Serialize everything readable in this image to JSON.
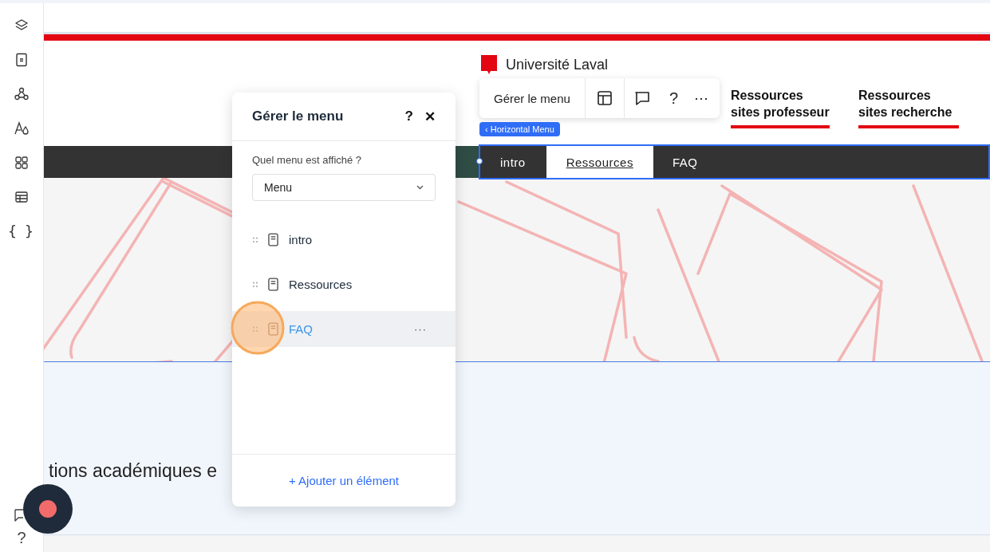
{
  "sidebar": {
    "code_label": "{ }",
    "help_label": "?"
  },
  "site": {
    "logo_text": "Université Laval",
    "links": [
      {
        "label": "Ressources sites professeur"
      },
      {
        "label": "Ressources sites recherche"
      }
    ],
    "nav_items": [
      {
        "label": "intro",
        "selected": false
      },
      {
        "label": "Ressources",
        "selected": true
      },
      {
        "label": "FAQ",
        "selected": false
      }
    ],
    "body_text": "tions académiques e"
  },
  "toolbar": {
    "label": "Gérer le menu",
    "help": "?",
    "more": "⋯"
  },
  "element_tag": "‹ Horizontal Menu",
  "panel": {
    "title": "Gérer le menu",
    "help": "?",
    "close": "✕",
    "question": "Quel menu est affiché ?",
    "select_value": "Menu",
    "items": [
      {
        "label": "intro",
        "selected": false
      },
      {
        "label": "Ressources",
        "selected": false
      },
      {
        "label": "FAQ",
        "selected": true
      }
    ],
    "more": "···",
    "add_label": "+ Ajouter un élément"
  }
}
